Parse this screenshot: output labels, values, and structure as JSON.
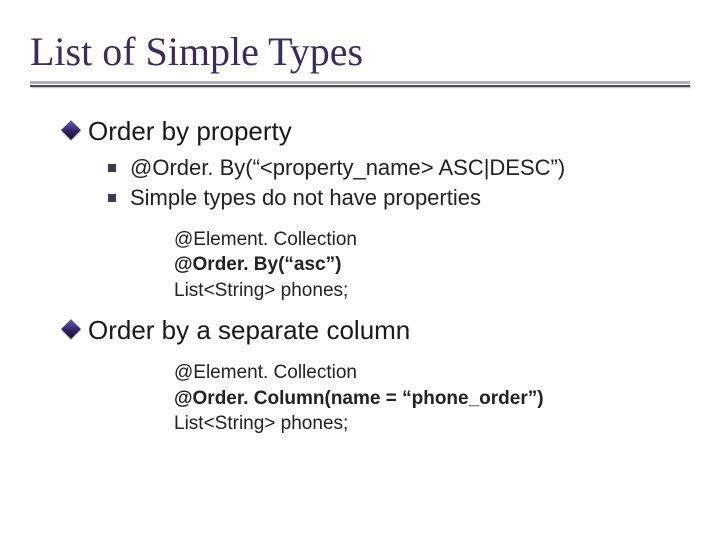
{
  "title": "List of Simple Types",
  "section1": {
    "heading": "Order by property",
    "bullets": [
      "@Order. By(“<property_name> ASC|DESC”)",
      "Simple types do not have properties"
    ],
    "code": [
      "@Element. Collection",
      "@Order. By(“asc”)",
      "List<String> phones;"
    ],
    "code_bold_index": 1
  },
  "section2": {
    "heading": "Order by a separate column",
    "code": [
      "@Element. Collection",
      "@Order. Column(name = “phone_order”)",
      "List<String> phones;"
    ],
    "code_bold_index": 1
  }
}
